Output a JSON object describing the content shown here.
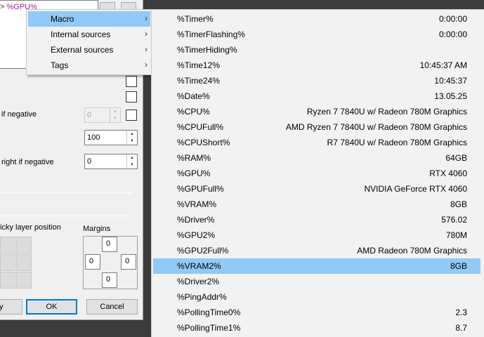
{
  "editor": {
    "prefix": ">",
    "macro_text": "%GPU%"
  },
  "dialog": {
    "label_negative": "if negative",
    "label_right_negative": "right if negative",
    "field_disabled_value": "0",
    "field_value_100": "100",
    "field_value_right": "0",
    "label_sticky": "icky layer position",
    "label_margins": "Margins",
    "margins": {
      "top": "0",
      "left": "0",
      "right": "0",
      "bottom": "0"
    },
    "btn_partial": "y",
    "btn_ok": "OK",
    "btn_cancel": "Cancel"
  },
  "menu": {
    "items": [
      {
        "label": "Macro"
      },
      {
        "label": "Internal sources"
      },
      {
        "label": "External sources"
      },
      {
        "label": "Tags"
      }
    ],
    "arrow": "›"
  },
  "submenu": {
    "items": [
      {
        "name": "%Timer%",
        "value": "0:00:00"
      },
      {
        "name": "%TimerFlashing%",
        "value": "0:00:00"
      },
      {
        "name": "%TimerHiding%",
        "value": ""
      },
      {
        "name": "%Time12%",
        "value": "10:45:37 AM"
      },
      {
        "name": "%Time24%",
        "value": "10:45:37"
      },
      {
        "name": "%Date%",
        "value": "13.05.25"
      },
      {
        "name": "%CPU%",
        "value": "Ryzen 7 7840U w/ Radeon 780M Graphics"
      },
      {
        "name": "%CPUFull%",
        "value": "AMD Ryzen 7 7840U w/ Radeon 780M Graphics"
      },
      {
        "name": "%CPUShort%",
        "value": "R7 7840U w/ Radeon 780M Graphics"
      },
      {
        "name": "%RAM%",
        "value": "64GB"
      },
      {
        "name": "%GPU%",
        "value": "RTX 4060"
      },
      {
        "name": "%GPUFull%",
        "value": "NVIDIA GeForce RTX 4060"
      },
      {
        "name": "%VRAM%",
        "value": "8GB"
      },
      {
        "name": "%Driver%",
        "value": "576.02"
      },
      {
        "name": "%GPU2%",
        "value": "780M"
      },
      {
        "name": "%GPU2Full%",
        "value": "AMD Radeon 780M Graphics"
      },
      {
        "name": "%VRAM2%",
        "value": "8GB"
      },
      {
        "name": "%Driver2%",
        "value": ""
      },
      {
        "name": "%PingAddr%",
        "value": ""
      },
      {
        "name": "%PollingTime0%",
        "value": "2.3"
      },
      {
        "name": "%PollingTime1%",
        "value": "8.7"
      }
    ]
  },
  "colors": {
    "highlight": "#91c9f7",
    "menu_bg": "#f2f2f2",
    "macro_text": "#a020a0",
    "default_button_border": "#0078d7"
  }
}
